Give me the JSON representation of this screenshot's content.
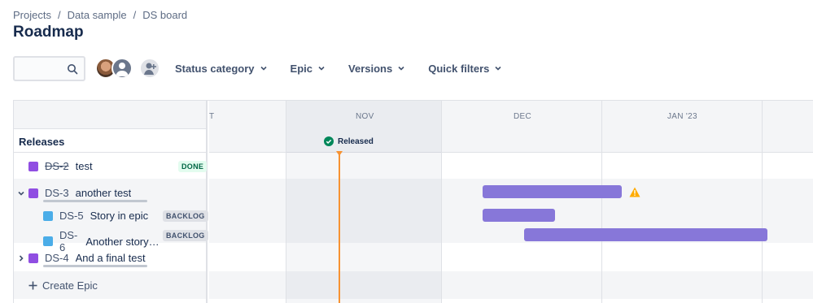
{
  "breadcrumb": {
    "items": [
      "Projects",
      "Data sample",
      "DS board"
    ],
    "separator": "/"
  },
  "page_title": "Roadmap",
  "toolbar": {
    "search_placeholder": "",
    "filters": [
      "Status category",
      "Epic",
      "Versions",
      "Quick filters"
    ]
  },
  "timeline": {
    "months": [
      "T",
      "NOV",
      "DEC",
      "JAN '23"
    ],
    "release_label": "Released"
  },
  "sidebar": {
    "releases_label": "Releases",
    "create_epic_label": "Create Epic"
  },
  "issues": [
    {
      "key": "DS-2",
      "summary": "test",
      "status": "DONE",
      "type": "epic"
    },
    {
      "key": "DS-3",
      "summary": "another test",
      "status": "",
      "type": "epic"
    },
    {
      "key": "DS-5",
      "summary": "Story in epic",
      "status": "BACKLOG",
      "type": "story"
    },
    {
      "key": "DS-6",
      "summary": "Another story in E...",
      "status": "BACKLOG",
      "type": "story"
    },
    {
      "key": "DS-4",
      "summary": "And a final test",
      "status": "",
      "type": "epic"
    }
  ],
  "colors": {
    "epic": "#904ee2",
    "story": "#4bade8",
    "bar": "#8777d9",
    "release": "#f79232",
    "warning": "#ffab00"
  },
  "icons": [
    "search-icon",
    "chevron-down-icon",
    "epic-icon",
    "story-icon",
    "check-circle-icon",
    "warning-icon",
    "plus-icon"
  ]
}
